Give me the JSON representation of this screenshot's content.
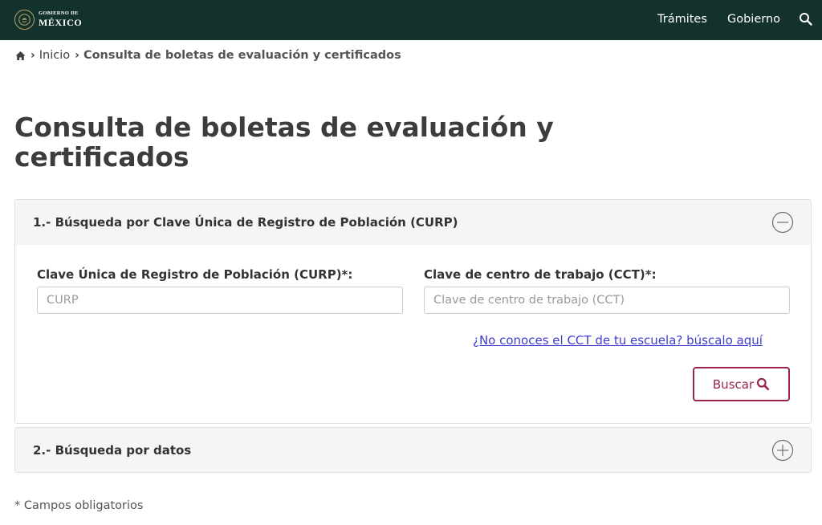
{
  "header": {
    "logo_line1": "GOBIERNO DE",
    "logo_line2": "MÉXICO",
    "nav_items": [
      "Trámites",
      "Gobierno"
    ],
    "search_icon": "search-icon",
    "background_color": "#13322b"
  },
  "breadcrumb": {
    "home_icon": "home-icon",
    "separator": "›",
    "items": [
      "Inicio",
      "Consulta de boletas de evaluación y certificados"
    ]
  },
  "page": {
    "title": "Consulta de boletas de evaluación y certificados"
  },
  "panels": [
    {
      "title": "1.- Búsqueda por Clave Única de Registro de Población (CURP)",
      "state": "expanded",
      "toggle_icon": "minus-circle-icon",
      "fields": [
        {
          "label": "Clave Única de Registro de Población (CURP)*:",
          "placeholder": "CURP",
          "value": ""
        },
        {
          "label": "Clave de centro de trabajo (CCT)*:",
          "placeholder": "Clave de centro de trabajo (CCT)",
          "value": ""
        }
      ],
      "help_link": "¿No conoces el CCT de tu escuela? búscalo aquí",
      "submit_label": "Buscar",
      "submit_icon": "search-icon"
    },
    {
      "title": "2.- Búsqueda por datos",
      "state": "collapsed",
      "toggle_icon": "plus-circle-icon"
    }
  ],
  "footer_note": "* Campos obligatorios",
  "colors": {
    "accent": "#9d2449",
    "link": "#3e3cd1",
    "panel_heading_bg": "#f5f5f5"
  }
}
